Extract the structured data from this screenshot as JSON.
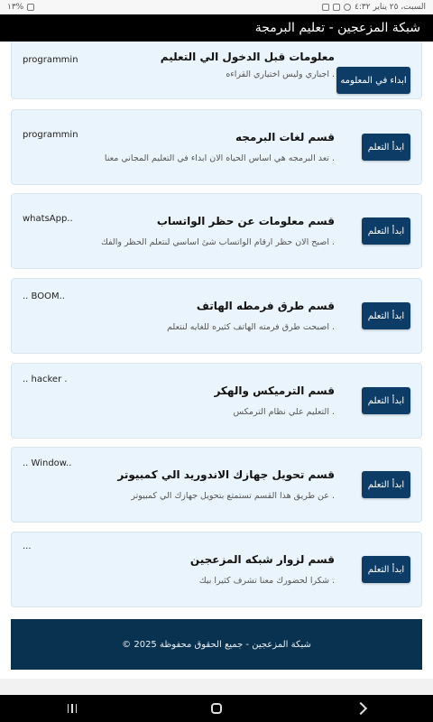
{
  "status_bar": {
    "time_date": "السبت، ٢٥ يناير ٤:٣٢",
    "battery": "%١٣"
  },
  "app": {
    "title": "شبكة المزعجين - تعليم البرمجة"
  },
  "cards": [
    {
      "title": "معلومات قبل الدخول الي التعليم",
      "desc": ". اجباري وليس اختياري القراءه",
      "button": "ابداء في المعلومه",
      "thumb": "programmin.."
    },
    {
      "title": "قسم لغات البرمجه",
      "desc": ". تعد البرمجه هي اساس الحياه الان ابداء في التعليم المجاني معنا",
      "button": "ابدأ التعلم",
      "thumb": "programmin.."
    },
    {
      "title": "قسم معلومات عن حظر الواتساب",
      "desc": ". اصبح الان حظر ارقام الواتساب شئ اساسي لنتعلم الحظر والفك",
      "button": "ابدأ التعلم",
      "thumb": "whatsApp.."
    },
    {
      "title": "قسم طرق فرمطه الهاتف",
      "desc": ". اصبحت طرق فرمته الهاتف كثيره للغايه لنتعلم",
      "button": "ابدأ التعلم",
      "thumb": ".. BOOM.."
    },
    {
      "title": "قسم الترميكس والهكر",
      "desc": ". التعليم علي نظام الترمكس",
      "button": "ابدأ التعلم",
      "thumb": ".. hacker ."
    },
    {
      "title": "قسم تحويل جهازك الاندوريد الي كمبيوتر",
      "desc": ". عن طريق هذا القسم تستمتع بتحويل جهازك الي كمبيوتر",
      "button": "ابدأ التعلم",
      "thumb": ".. Window.."
    },
    {
      "title": "قسم لزوار شبكه المزعجين",
      "desc": ". شكرا لحضورك معنا تشرف كثيرا بيك",
      "button": "ابدأ التعلم",
      "thumb": "..."
    }
  ],
  "footer": {
    "text": "شبكة المزعجين - جميع الحقوق محفوظة 2025 ©"
  },
  "colors": {
    "button_bg": "#0d3d66",
    "footer_bg": "#08324f",
    "card_bg": "#eaf4fc"
  }
}
